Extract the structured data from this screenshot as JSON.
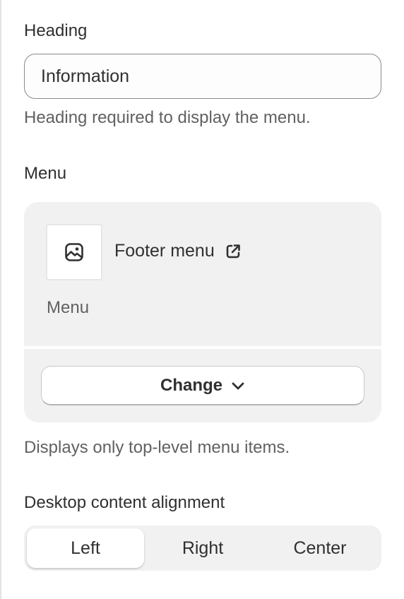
{
  "heading_field": {
    "label": "Heading",
    "value": "Information",
    "help_text": "Heading required to display the menu."
  },
  "menu_field": {
    "label": "Menu",
    "selected_menu": {
      "name": "Footer menu",
      "type": "Menu",
      "thumbnail_icon": "image-icon",
      "link_icon": "external-link-icon"
    },
    "change_button": {
      "label": "Change",
      "icon": "chevron-down-icon"
    },
    "help_text": "Displays only top-level menu items."
  },
  "alignment_field": {
    "label": "Desktop content alignment",
    "options": [
      "Left",
      "Right",
      "Center"
    ],
    "selected": "Left"
  },
  "colors": {
    "text": "#303030",
    "subdued_text": "#616161",
    "card_background": "#f1f1f1",
    "input_border": "#8a8a8a"
  }
}
